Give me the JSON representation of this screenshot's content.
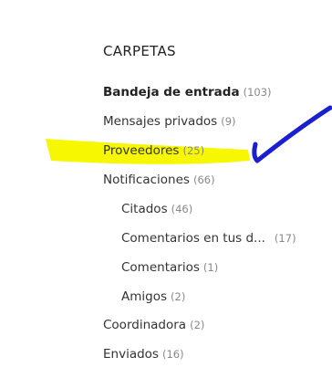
{
  "folders": {
    "title": "CARPETAS",
    "items": [
      {
        "name": "Bandeja de entrada",
        "count": "103",
        "active": true
      },
      {
        "name": "Mensajes privados",
        "count": "9"
      },
      {
        "name": "Proveedores",
        "count": "25",
        "highlighted": true
      },
      {
        "name": "Notificaciones",
        "count": "66"
      },
      {
        "name": "Citados",
        "count": "46",
        "sub": true
      },
      {
        "name": "Comentarios en tus d...",
        "count": "17",
        "sub": true
      },
      {
        "name": "Comentarios",
        "count": "1",
        "sub": true
      },
      {
        "name": "Amigos",
        "count": "2",
        "sub": true
      },
      {
        "name": "Coordinadora",
        "count": "2"
      },
      {
        "name": "Enviados",
        "count": "16"
      }
    ]
  },
  "annotations": {
    "highlight_color": "#f6f700",
    "checkmark_color": "#1a1fd0"
  }
}
